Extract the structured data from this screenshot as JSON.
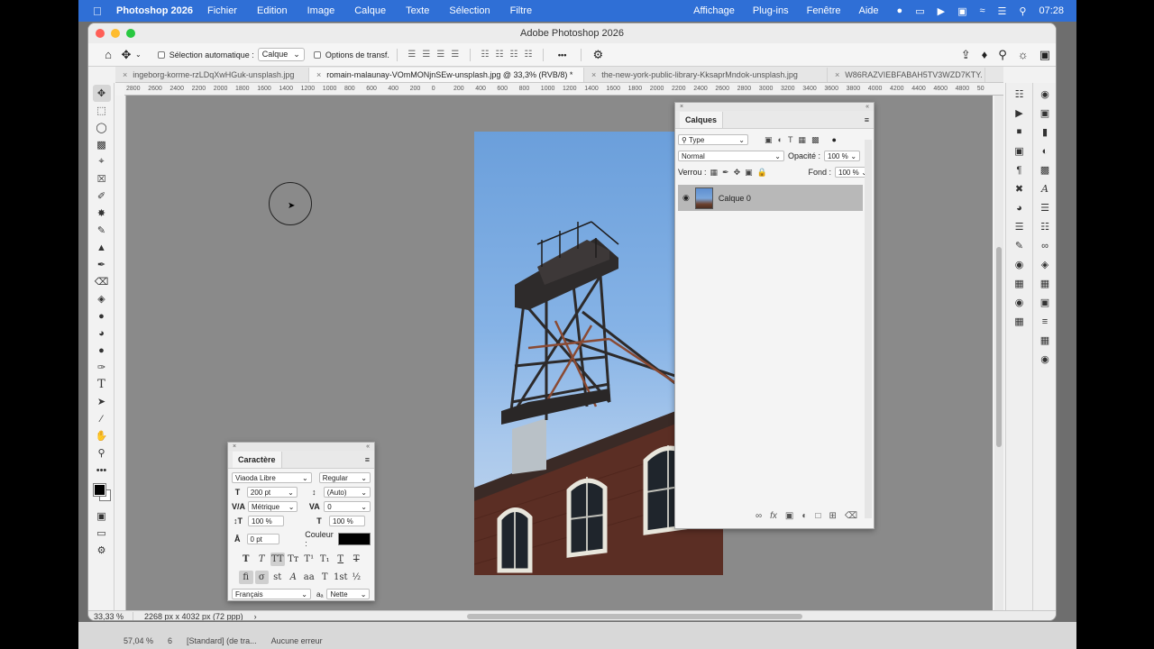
{
  "menubar": {
    "app_name": "Photoshop 2026",
    "menus": [
      "Fichier",
      "Edition",
      "Image",
      "Calque",
      "Texte",
      "Sélection",
      "Filtre"
    ],
    "right_menus": [
      "Affichage",
      "Plug-ins",
      "Fenêtre",
      "Aide"
    ],
    "clock": "07:28"
  },
  "window": {
    "title": "Adobe Photoshop 2026"
  },
  "options": {
    "auto_select_label": "Sélection automatique :",
    "auto_select_value": "Calque",
    "transform_label": "Options de transf.",
    "more": "•••"
  },
  "tabs": [
    {
      "label": "ingeborg-korme-rzLDqXwHGuk-unsplash.jpg",
      "active": false
    },
    {
      "label": "romain-malaunay-VOmMONjnSEw-unsplash.jpg @ 33,3% (RVB/8) *",
      "active": true
    },
    {
      "label": "the-new-york-public-library-KksaprMndok-unsplash.jpg",
      "active": false
    },
    {
      "label": "W86RAZVIEBFABAH5TV3WZD7KTY.",
      "active": false
    }
  ],
  "ruler": [
    "2800",
    "2600",
    "2400",
    "2200",
    "2000",
    "1800",
    "1600",
    "1400",
    "1200",
    "1000",
    "800",
    "600",
    "400",
    "200",
    "0",
    "200",
    "400",
    "600",
    "800",
    "1000",
    "1200",
    "1400",
    "1600",
    "1800",
    "2000",
    "2200",
    "2400",
    "2600",
    "2800",
    "3000",
    "3200",
    "3400",
    "3600",
    "3800",
    "4000",
    "4200",
    "4400",
    "4600",
    "4800",
    "50"
  ],
  "status": {
    "zoom": "33,33 %",
    "info": "2268 px x 4032 px (72 ppp)",
    "arrow": "›"
  },
  "layers_panel": {
    "title": "Calques",
    "filter": "Type",
    "blend_mode": "Normal",
    "opacity_label": "Opacité :",
    "opacity_value": "100 %",
    "lock_label": "Verrou :",
    "fill_label": "Fond :",
    "fill_value": "100 %",
    "layer_name": "Calque 0"
  },
  "char_panel": {
    "title": "Caractère",
    "font": "Viaoda Libre",
    "style": "Regular",
    "size": "200 pt",
    "leading": "(Auto)",
    "kerning": "Métrique",
    "tracking": "0",
    "vscale": "100 %",
    "hscale": "100 %",
    "baseline": "0 pt",
    "color_label": "Couleur :",
    "color_value": "#000000",
    "language": "Français",
    "aa_label": "aₐ",
    "antialias": "Nette"
  },
  "desktop_status": {
    "left": "57,04 %",
    "page": "6",
    "style": "[Standard] (de tra...",
    "errors": "Aucune erreur"
  }
}
